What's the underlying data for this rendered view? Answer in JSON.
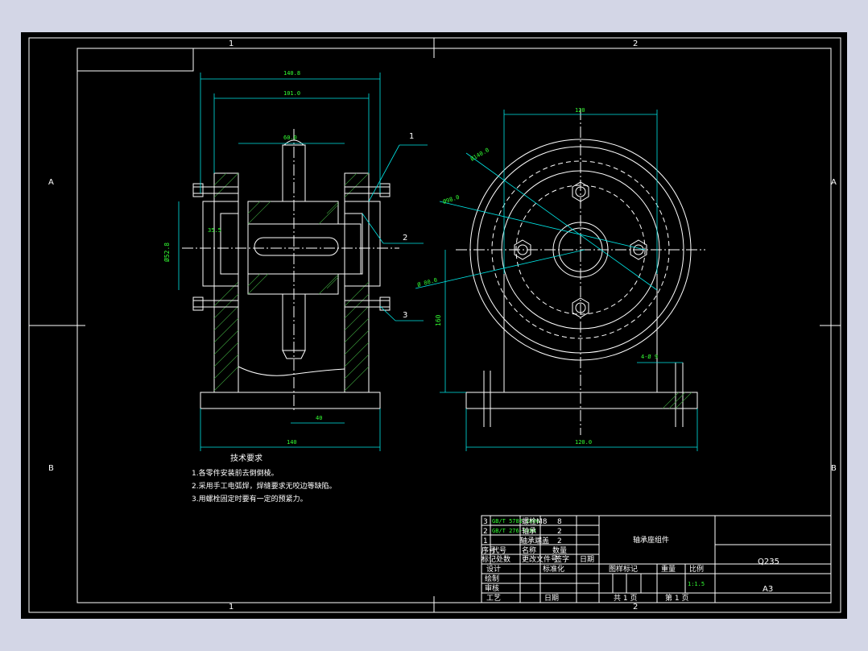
{
  "border_zones": {
    "top": [
      "1",
      "2"
    ],
    "bottom": [
      "1",
      "2"
    ],
    "left": [
      "A",
      "B"
    ],
    "right": [
      "A",
      "B"
    ]
  },
  "dimensions": {
    "front_width_outer": "140.8",
    "front_width_inner": "101.0",
    "front_shaft": "60.0",
    "front_bore": "Ø52.8",
    "front_small": "35.5",
    "front_base_inner": "40",
    "front_base": "140",
    "side_top": "120",
    "side_d1": "Ø140.0",
    "side_d2": "Ø98.0",
    "side_d3": "Ø 80.0",
    "side_height": "160",
    "side_base": "120.0",
    "side_holes": "4-Ø 9"
  },
  "leaders": [
    "1",
    "2",
    "3"
  ],
  "notes": {
    "title": "技术要求",
    "items": [
      "1.各零件安装前去倒倒棱。",
      "2.采用手工电弧焊，焊缝要求无咬边等缺陷。",
      "3.用螺栓固定时要有一定的预紧力。"
    ]
  },
  "title_block": {
    "parts": [
      {
        "no": "3",
        "code": "GB/T 5782-2000",
        "name": "螺栓M8",
        "qty": "8"
      },
      {
        "no": "2",
        "code": "GB/T 276-1994",
        "name": "轴承",
        "qty": "2"
      },
      {
        "no": "1",
        "code": "",
        "name": "轴承端盖",
        "qty": "2"
      }
    ],
    "header": {
      "no": "序号",
      "code": "代号",
      "name": "名称",
      "qty": "数量"
    },
    "rev_row": [
      "标记",
      "处数",
      "更改文件号",
      "签字",
      "日期"
    ],
    "design": "设计",
    "standardize": "标准化",
    "draw": "绘制",
    "check": "审核",
    "process": "工艺",
    "date": "日期",
    "drawing_title": "轴承座组件",
    "stage_label": "图样标记",
    "weight_label": "重量",
    "scale_label": "比例",
    "scale": "1:1.5",
    "sheets_total": "共 1 页",
    "sheet_no": "第 1 页",
    "material": "Q235",
    "size": "A3"
  },
  "colors": {
    "background": "#000000",
    "frame": "#d3d6e6",
    "lines": "#ffffff",
    "dimension": "#00e5e5",
    "dim_text": "#33ff33"
  }
}
